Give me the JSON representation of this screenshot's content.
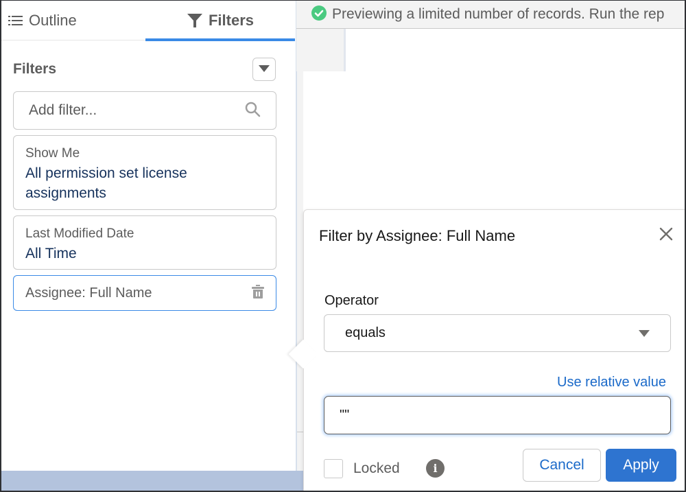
{
  "tabs": [
    {
      "label": "Outline",
      "icon": "list-icon",
      "active": false
    },
    {
      "label": "Filters",
      "icon": "funnel-icon",
      "active": true
    }
  ],
  "filters_panel": {
    "title": "Filters",
    "add_filter_placeholder": "Add filter...",
    "cards": [
      {
        "label": "Show Me",
        "value": "All permission set license assignments"
      },
      {
        "label": "Last Modified Date",
        "value": "All Time"
      },
      {
        "label": "Assignee: Full Name",
        "value": ""
      }
    ]
  },
  "banner": {
    "icon": "success-check-icon",
    "text": "Previewing a limited number of records. Run the rep",
    "icon_color": "#4bca81"
  },
  "popover": {
    "title": "Filter by Assignee: Full Name",
    "operator_label": "Operator",
    "operator_value": "equals",
    "relative_link": "Use relative value",
    "value": "\"\"",
    "locked_label": "Locked",
    "locked_checked": false,
    "cancel_label": "Cancel",
    "apply_label": "Apply"
  },
  "colors": {
    "accent": "#3a8ae6",
    "primary_button": "#2e74d0",
    "link": "#1b6ac9",
    "value_text": "#16325c"
  }
}
